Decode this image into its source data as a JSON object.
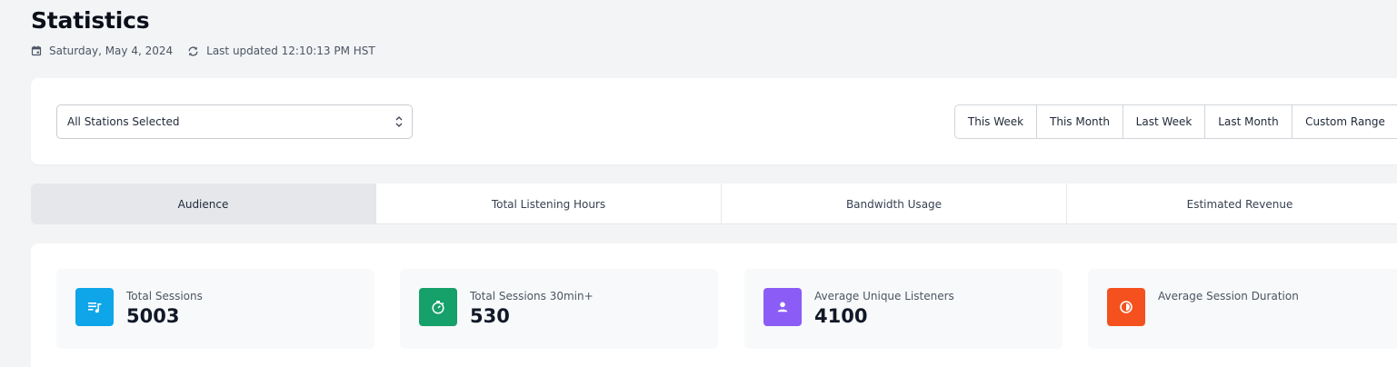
{
  "header": {
    "title": "Statistics",
    "date": "Saturday, May 4, 2024",
    "last_updated": "Last updated 12:10:13 PM HST"
  },
  "filters": {
    "station_select": {
      "value": "All Stations Selected"
    },
    "ranges": [
      {
        "label": "This Week"
      },
      {
        "label": "This Month"
      },
      {
        "label": "Last Week"
      },
      {
        "label": "Last Month"
      },
      {
        "label": "Custom Range"
      }
    ]
  },
  "tabs": [
    {
      "label": "Audience",
      "active": true
    },
    {
      "label": "Total Listening Hours"
    },
    {
      "label": "Bandwidth Usage"
    },
    {
      "label": "Estimated Revenue"
    }
  ],
  "stats": [
    {
      "label": "Total Sessions",
      "value": "5003",
      "icon": "playlist-music-icon",
      "color": "#0ea5e9"
    },
    {
      "label": "Total Sessions 30min+",
      "value": "530",
      "icon": "timer-icon",
      "color": "#16a06a"
    },
    {
      "label": "Average Unique Listeners",
      "value": "4100",
      "icon": "user-icon",
      "color": "#8b5cf6"
    },
    {
      "label": "Average Session Duration",
      "value": "",
      "icon": "pie-clock-icon",
      "color": "#f4511e"
    }
  ]
}
